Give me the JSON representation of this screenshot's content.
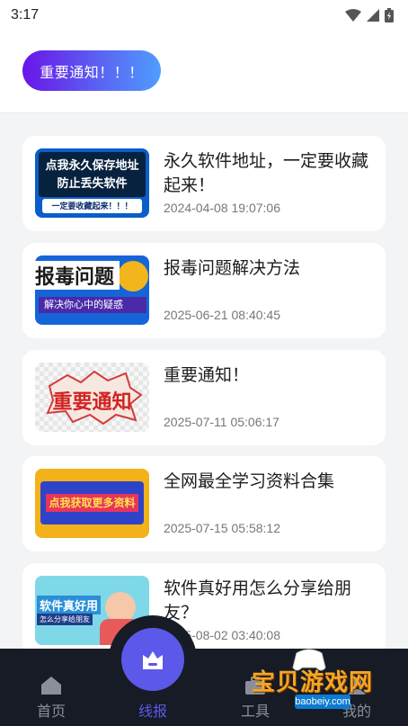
{
  "status": {
    "time": "3:17"
  },
  "header": {
    "notice_label": "重要通知！！！"
  },
  "articles": [
    {
      "title": "永久软件地址，一定要收藏起来！",
      "date": "2024-04-08 19:07:06",
      "thumb": {
        "line1": "点我永久保存地址",
        "line2": "防止丢失软件",
        "line3": "一定要收藏起来！！！"
      }
    },
    {
      "title": "报毒问题解决方法",
      "date": "2025-06-21 08:40:45",
      "thumb": {
        "line1": "报毒问题",
        "line2": "解决你心中的疑惑"
      }
    },
    {
      "title": "重要通知！",
      "date": "2025-07-11 05:06:17",
      "thumb": {
        "line1": "重要通知"
      }
    },
    {
      "title": "全网最全学习资料合集",
      "date": "2025-07-15 05:58:12",
      "thumb": {
        "line1": "点我获取更多资料"
      }
    },
    {
      "title": "软件真好用怎么分享给朋友？",
      "date": "2025-08-02 03:40:08",
      "thumb": {
        "line1": "软件真好用",
        "line2": "怎么分享给朋友"
      }
    }
  ],
  "nav": {
    "home": "首页",
    "news": "线报",
    "tools": "工具",
    "mine": "我的"
  },
  "watermark": {
    "name": "宝贝游戏网",
    "url": "baobeiy.com"
  },
  "colors": {
    "accent": "#5b58ea",
    "nav_bg": "#161b25",
    "page_bg": "#f3f4f6"
  }
}
